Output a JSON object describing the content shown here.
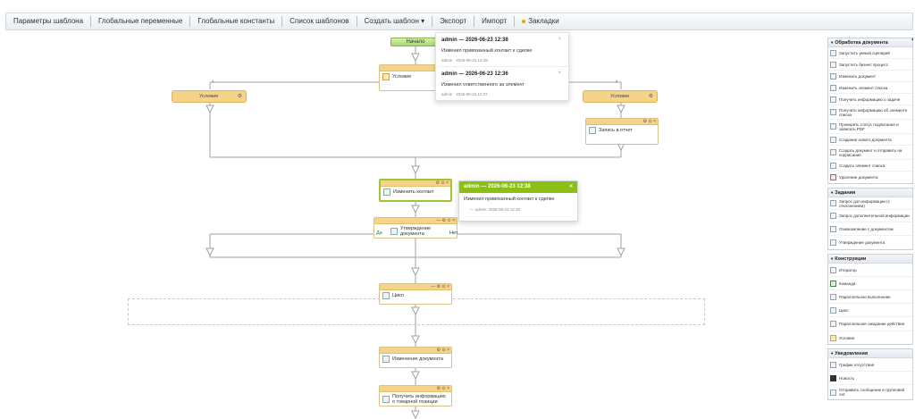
{
  "toolbar": {
    "items": [
      "Параметры шаблона",
      "Глобальные переменные",
      "Глобальные константы",
      "Список шаблонов",
      "Создать шаблон ▾",
      "Экспорт",
      "Импорт",
      "Закладки"
    ]
  },
  "canvas": {
    "start_label": "Начало",
    "condition_main": "Условие",
    "condition_left": "Условие",
    "condition_right": "Условие",
    "node_report": "Запись в отчет",
    "node_change_contact": "Изменить контакт",
    "node_approve": "Утверждение документа",
    "branch_yes": "Да",
    "branch_no": "Нет",
    "node_cycle": "Цикл",
    "node_change_doc": "Изменение документа",
    "node_get_info": "Получить информацию о товарной позиции"
  },
  "notifications": [
    {
      "title": "admin — 2026-06-23 12:38",
      "text": "Изменил привязанный контакт к сделке",
      "meta": "admin · 2026-06-23 12:39"
    },
    {
      "title": "admin — 2026-06-23 12:36",
      "text": "Изменил ответственного за элемент",
      "meta": "admin · 2026-06-23 12:37"
    }
  ],
  "tooltip": {
    "title": "admin — 2026-06-23 12:38",
    "text": "Изменил привязанный контакт к сделке",
    "meta": "— admin, 2026-06-23 12:39"
  },
  "panel": {
    "sections": [
      {
        "title": "Обработка документа",
        "items": [
          "Запустить умный сценарий",
          "Запустить бизнес процесс",
          "Изменить документ",
          "Изменить элемент списка",
          "Получить информацию о задаче",
          "Получить информацию об элементе списка",
          "Проверить статус подписания и записать PDF",
          "Создание нового документа",
          "Создать документ и отправить на подписание",
          "Создать элемент списка",
          "Удаление документа"
        ]
      },
      {
        "title": "Задания",
        "items": [
          "Запрос доп.информации (с отклонением)",
          "Запрос дополнительной информации",
          "Ознакомление с документом",
          "Утверждение документа"
        ]
      },
      {
        "title": "Конструкции",
        "items": [
          "Итератор",
          "Команда",
          "Параллельное выполнение",
          "Цикл",
          "Параллельное ожидание действия",
          "Условие"
        ]
      },
      {
        "title": "Уведомления",
        "items": [
          "График отсутствия",
          "Новость",
          "Отправить сообщение в групповой чат"
        ]
      }
    ]
  }
}
